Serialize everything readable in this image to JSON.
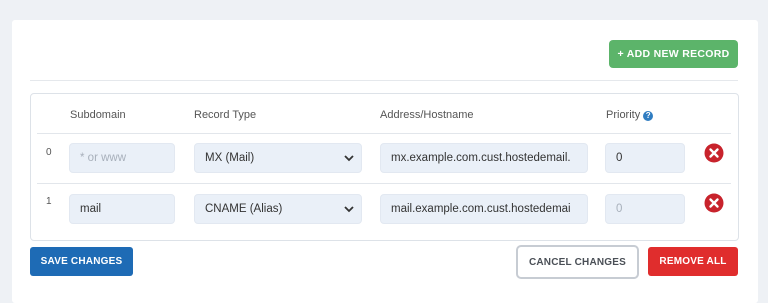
{
  "toolbar": {
    "add_label": "+ ADD NEW RECORD"
  },
  "table": {
    "headers": {
      "subdomain": "Subdomain",
      "record_type": "Record Type",
      "address": "Address/Hostname",
      "priority": "Priority"
    },
    "rows": [
      {
        "index": "0",
        "subdomain": "",
        "subdomain_placeholder": "* or www",
        "record_type": "MX (Mail)",
        "address": "mx.example.com.cust.hostedemail.",
        "priority": "0",
        "priority_placeholder": ""
      },
      {
        "index": "1",
        "subdomain": "mail",
        "subdomain_placeholder": "",
        "record_type": "CNAME (Alias)",
        "address": "mail.example.com.cust.hostedemai",
        "priority": "",
        "priority_placeholder": "0"
      }
    ]
  },
  "footer": {
    "save_label": "SAVE CHANGES",
    "cancel_label": "CANCEL CHANGES",
    "remove_label": "REMOVE ALL"
  },
  "icons": {
    "help": "question-circle-icon",
    "delete": "close-circle-icon",
    "select": "chevron-down-icon"
  },
  "colors": {
    "add_button": "#5cb46a",
    "save_button": "#1e6bb5",
    "remove_button": "#e02d2d",
    "delete_icon": "#c8232c",
    "field_bg": "#eaf0f8"
  }
}
